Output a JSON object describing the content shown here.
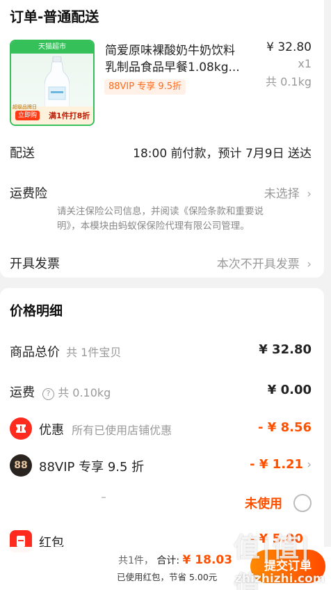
{
  "order": {
    "section_title": "订单-普通配送",
    "product": {
      "name_line1": "简爱原味裸酸奶牛奶饮料",
      "name_line2": "乳制品食品早餐1.08kg...",
      "price": "¥ 32.80",
      "quantity": "x1",
      "weight": "共 0.1kg",
      "vip_tag": "88VIP 专享 9.5折",
      "thumb_header": "天猫超市",
      "thumb_badge": "立即购",
      "thumb_subbadge": "超级品牌日",
      "thumb_discount": "满1件打8折"
    },
    "delivery": {
      "label": "配送",
      "value": "18:00 前付款，预计 7月9日 送达"
    },
    "insurance": {
      "label": "运费险",
      "value": "未选择",
      "note_line1": "请关注保险公司信息，并阅读《保险条款和重要说",
      "note_line2": "明》，本模块由蚂蚁保保险代理有限公司管理。"
    },
    "invoice": {
      "label": "开具发票",
      "value": "本次不开具发票"
    }
  },
  "price_detail": {
    "title": "价格明细",
    "goods_total": {
      "label": "商品总价",
      "sub": "共 1件宝贝",
      "value": "¥ 32.80"
    },
    "shipping": {
      "label": "运费",
      "help_icon": "?",
      "sub": "共 0.10kg",
      "value": "¥ 0.00"
    },
    "discount": {
      "label": "优惠",
      "sub": "所有已使用店铺优惠",
      "value": "- ¥ 8.56",
      "icon": "coupon-icon"
    },
    "vip": {
      "badge": "88",
      "label": "88VIP 专享 9.5 折",
      "value": "- ¥ 1.21"
    },
    "unused_row": {
      "value": "未使用"
    },
    "red_packet": {
      "label": "红包",
      "value": "- ¥ 5.00"
    }
  },
  "bottom": {
    "count": "共1件，",
    "total_label": "合计:",
    "total_value": "¥ 18.03",
    "note": "已使用红包，节省 5.00元",
    "submit": "提交订单"
  },
  "watermark": {
    "main": "值|值|值",
    "site": "zhizhizhi.com"
  },
  "colors": {
    "accent": "#ff5000",
    "green": "#36c05a",
    "coupon_red": "#ff2b1e",
    "vip_dark": "#2a2420"
  }
}
